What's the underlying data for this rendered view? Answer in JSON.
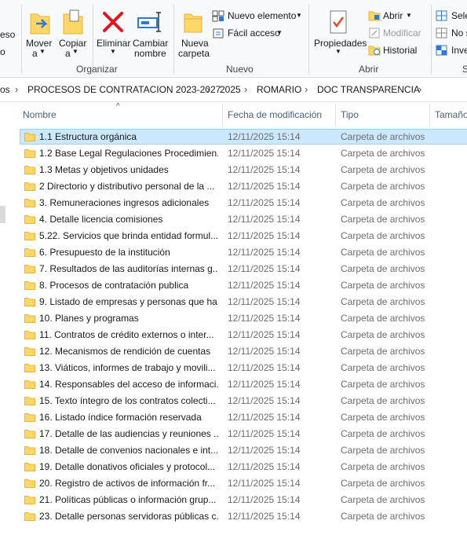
{
  "ribbon": {
    "clipped_left_top": "eso",
    "clipped_left_bottom": "o",
    "move_label": "Mover",
    "move_sub": "a",
    "copy_label": "Copiar",
    "copy_sub": "a",
    "delete_label": "Eliminar",
    "rename_label_1": "Cambiar",
    "rename_label_2": "nombre",
    "organize_group": "Organizar",
    "new_folder_label_1": "Nueva",
    "new_folder_label_2": "carpeta",
    "new_item_label": "Nuevo elemento",
    "easy_access_label": "Fácil acceso",
    "new_group": "Nuevo",
    "properties_label": "Propiedades",
    "open_label": "Abrir",
    "edit_label": "Modificar",
    "history_label": "Historial",
    "open_group": "Abrir",
    "select_all_clipped": "Sele",
    "select_none_clipped": "No s",
    "invert_clipped": "Inve",
    "select_group_clipped": "S"
  },
  "breadcrumb": [
    "os",
    "PROCESOS DE CONTRATACION 2023-2027",
    "2025",
    "ROMARIO",
    "DOC TRANSPARENCIA"
  ],
  "columns": {
    "name": "Nombre",
    "date": "Fecha de modificación",
    "type": "Tipo",
    "size": "Tamaño"
  },
  "files": [
    {
      "name": "1.1 Estructura orgánica",
      "date": "12/11/2025 15:14",
      "type": "Carpeta de archivos"
    },
    {
      "name": "1.2 Base Legal Regulaciones Procedimien...",
      "date": "12/11/2025 15:14",
      "type": "Carpeta de archivos"
    },
    {
      "name": "1.3 Metas y objetivos unidades",
      "date": "12/11/2025 15:14",
      "type": "Carpeta de archivos"
    },
    {
      "name": "2 Directorio y distributivo personal de la ...",
      "date": "12/11/2025 15:14",
      "type": "Carpeta de archivos"
    },
    {
      "name": "3. Remuneraciones ingresos adicionales",
      "date": "12/11/2025 15:14",
      "type": "Carpeta de archivos"
    },
    {
      "name": "4. Detalle licencia comisiones",
      "date": "12/11/2025 15:14",
      "type": "Carpeta de archivos"
    },
    {
      "name": "5.22. Servicios que brinda entidad formul...",
      "date": "12/11/2025 15:14",
      "type": "Carpeta de archivos"
    },
    {
      "name": "6. Presupuesto de la institución",
      "date": "12/11/2025 15:14",
      "type": "Carpeta de archivos"
    },
    {
      "name": "7. Resultados de las auditorías internas  g...",
      "date": "12/11/2025 15:14",
      "type": "Carpeta de archivos"
    },
    {
      "name": "8. Procesos de contratación publica",
      "date": "12/11/2025 15:14",
      "type": "Carpeta de archivos"
    },
    {
      "name": "9. Listado de empresas y personas que ha...",
      "date": "12/11/2025 15:14",
      "type": "Carpeta de archivos"
    },
    {
      "name": "10. Planes y programas",
      "date": "12/11/2025 15:14",
      "type": "Carpeta de archivos"
    },
    {
      "name": "11. Contratos de crédito externos o inter...",
      "date": "12/11/2025 15:14",
      "type": "Carpeta de archivos"
    },
    {
      "name": "12. Mecanismos de rendición de cuentas",
      "date": "12/11/2025 15:14",
      "type": "Carpeta de archivos"
    },
    {
      "name": "13. Viáticos, informes de trabajo y movili...",
      "date": "12/11/2025 15:14",
      "type": "Carpeta de archivos"
    },
    {
      "name": "14. Responsables del acceso de informaci...",
      "date": "12/11/2025 15:14",
      "type": "Carpeta de archivos"
    },
    {
      "name": "15. Texto íntegro de los contratos colecti...",
      "date": "12/11/2025 15:14",
      "type": "Carpeta de archivos"
    },
    {
      "name": "16. Listado índice formación reservada",
      "date": "12/11/2025 15:14",
      "type": "Carpeta de archivos"
    },
    {
      "name": "17. Detalle de las audiencias y reuniones ...",
      "date": "12/11/2025 15:14",
      "type": "Carpeta de archivos"
    },
    {
      "name": "18. Detalle de convenios nacionales e int...",
      "date": "12/11/2025 15:14",
      "type": "Carpeta de archivos"
    },
    {
      "name": "19. Detalle donativos oficiales y protocol...",
      "date": "12/11/2025 15:14",
      "type": "Carpeta de archivos"
    },
    {
      "name": "20. Registro de activos de información fr...",
      "date": "12/11/2025 15:14",
      "type": "Carpeta de archivos"
    },
    {
      "name": "21. Políticas públicas o información grup...",
      "date": "12/11/2025 15:14",
      "type": "Carpeta de archivos"
    },
    {
      "name": "23. Detalle personas servidoras públicas c...",
      "date": "12/11/2025 15:14",
      "type": "Carpeta de archivos"
    }
  ],
  "colors": {
    "selection_bg": "#cce8ff",
    "selection_border": "#99d1ff",
    "folder": "#ffd767",
    "header_text": "#4c607a"
  }
}
